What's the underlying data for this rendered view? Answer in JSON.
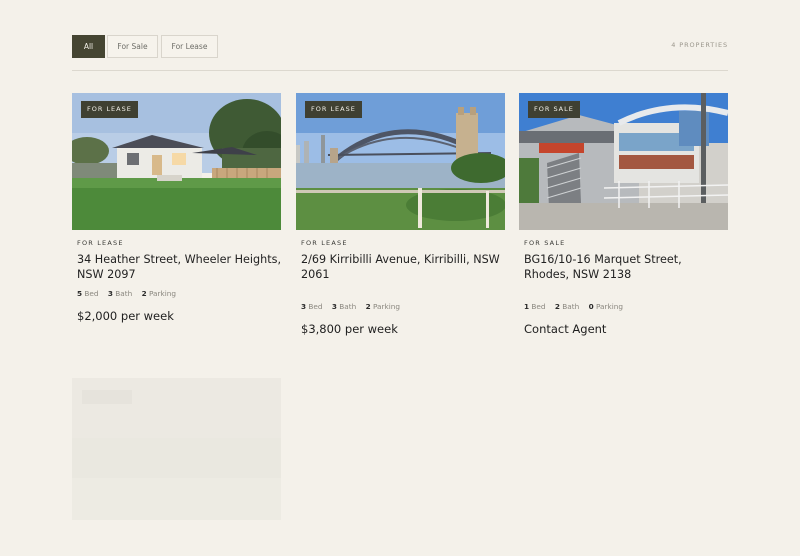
{
  "filters": {
    "tabs": [
      {
        "label": "All",
        "active": true
      },
      {
        "label": "For Sale",
        "active": false
      },
      {
        "label": "For Lease",
        "active": false
      }
    ],
    "count_label": "4 PROPERTIES"
  },
  "listings": [
    {
      "badge": "FOR LEASE",
      "status": "FOR LEASE",
      "address": "34 Heather Street, Wheeler Heights, NSW 2097",
      "bed": "5",
      "bed_label": "Bed",
      "bath": "3",
      "bath_label": "Bath",
      "parking": "2",
      "parking_label": "Parking",
      "price": "$2,000 per week"
    },
    {
      "badge": "FOR LEASE",
      "status": "FOR LEASE",
      "address": "2/69 Kirribilli Avenue, Kirribilli, NSW 2061",
      "bed": "3",
      "bed_label": "Bed",
      "bath": "3",
      "bath_label": "Bath",
      "parking": "2",
      "parking_label": "Parking",
      "price": "$3,800 per week"
    },
    {
      "badge": "FOR SALE",
      "status": "FOR SALE",
      "address": "BG16/10-16 Marquet Street, Rhodes, NSW 2138",
      "bed": "1",
      "bed_label": "Bed",
      "bath": "2",
      "bath_label": "Bath",
      "parking": "0",
      "parking_label": "Parking",
      "price": "Contact Agent"
    }
  ],
  "colors": {
    "background": "#f4f1ea",
    "accent": "#454532",
    "badge": "#3f4032"
  }
}
